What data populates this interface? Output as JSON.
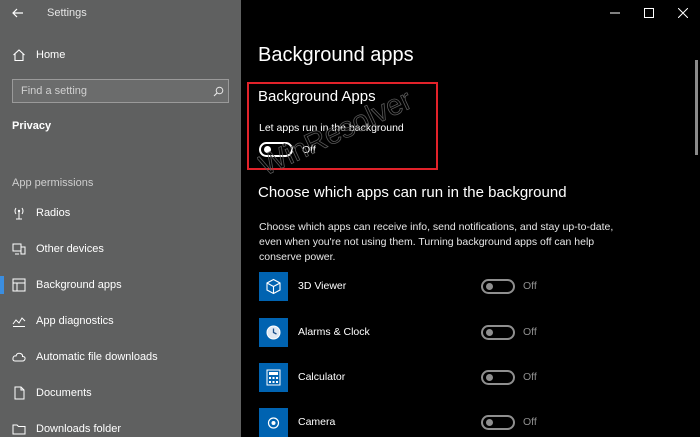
{
  "app_title": "Settings",
  "sidebar": {
    "home_label": "Home",
    "search_placeholder": "Find a setting",
    "section": "Privacy",
    "group_header": "App permissions",
    "items": [
      {
        "label": "Radios",
        "icon": "radio-icon"
      },
      {
        "label": "Other devices",
        "icon": "devices-icon"
      },
      {
        "label": "Background apps",
        "icon": "background-apps-icon",
        "active": true
      },
      {
        "label": "App diagnostics",
        "icon": "diagnostics-icon"
      },
      {
        "label": "Automatic file downloads",
        "icon": "cloud-icon"
      },
      {
        "label": "Documents",
        "icon": "document-icon"
      },
      {
        "label": "Downloads folder",
        "icon": "folder-icon"
      }
    ]
  },
  "main": {
    "page_title": "Background apps",
    "section1": {
      "title": "Background Apps",
      "toggle_label": "Let apps run in the background",
      "toggle_state": "Off"
    },
    "section2": {
      "title": "Choose which apps can run in the background",
      "description": "Choose which apps can receive info, send notifications, and stay up-to-date, even when you're not using them. Turning background apps off can help conserve power."
    },
    "apps": [
      {
        "name": "3D Viewer",
        "state": "Off",
        "icon": "cube-icon"
      },
      {
        "name": "Alarms & Clock",
        "state": "Off",
        "icon": "clock-icon"
      },
      {
        "name": "Calculator",
        "state": "Off",
        "icon": "calculator-icon"
      },
      {
        "name": "Camera",
        "state": "Off",
        "icon": "camera-icon"
      }
    ]
  },
  "watermark": "WinResolver",
  "colors": {
    "sidebar_bg": "#5f6060",
    "main_bg": "#000000",
    "accent": "#3b8ee0",
    "app_tile": "#0063b1",
    "highlight_border": "#e2222a"
  }
}
